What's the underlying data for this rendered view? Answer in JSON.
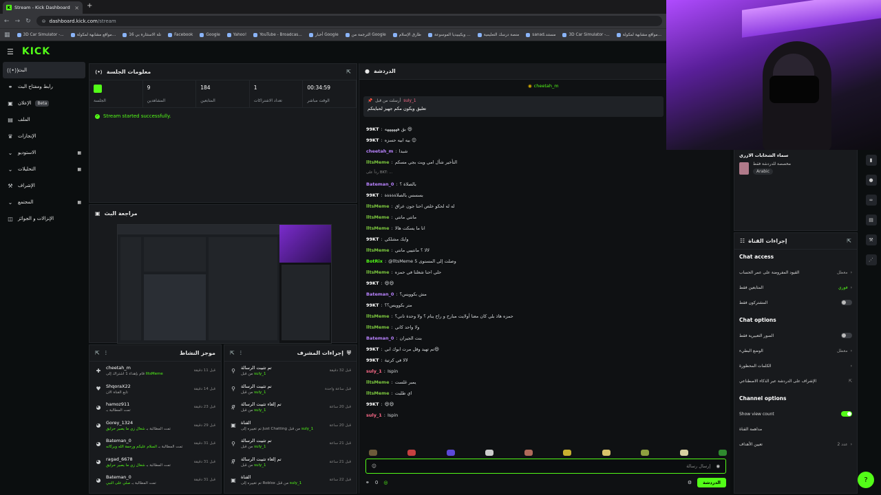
{
  "browser": {
    "tab_title": "Stream - Kick Dashboard",
    "url_host": "dashboard.kick.com",
    "url_path": "/stream",
    "bookmarks": [
      "3D Car Simulator -...",
      "مواقع مشابهة لمكولة...",
      "تلة الاستثارة بي 16",
      "Facebook",
      "Google",
      "Yahoo!",
      "YouTube - Broadcas...",
      "أخبار Google",
      "الترجمة من Google",
      "طارق الإسلام",
      "ويكيبيديا الموسوعة ...",
      "منصة درسك التعليمية",
      "sanad.مستند",
      "3D Car Simulator -...",
      "مواقع مشابهة لمكولة..."
    ]
  },
  "sidebar": {
    "items": [
      {
        "label": "البث",
        "icon": "broadcast-icon",
        "active": true
      },
      {
        "label": "رابط ومفتاح البث",
        "icon": "link-icon"
      },
      {
        "label": "الإعلان",
        "icon": "ads-icon",
        "badge": "Beta"
      },
      {
        "label": "الملف",
        "icon": "file-icon"
      },
      {
        "label": "الإنجازات",
        "icon": "trophy-icon"
      },
      {
        "label": "الاستوديو",
        "icon": "studio-icon",
        "chev": true
      },
      {
        "label": "التحليلات",
        "icon": "analytics-icon",
        "chev": true
      },
      {
        "label": "الإشراف",
        "icon": "moderation-icon"
      },
      {
        "label": "المجتمع",
        "icon": "community-icon",
        "chev": true
      },
      {
        "label": "الإنزالات و الجوائز",
        "icon": "drops-icon"
      }
    ]
  },
  "session": {
    "title": "معلومات الجلسة",
    "stats": [
      {
        "value": "",
        "label": "الجلسة"
      },
      {
        "value": "9",
        "label": "المشاهدين"
      },
      {
        "value": "184",
        "label": "المتابعين"
      },
      {
        "value": "1",
        "label": "تعداد الاشتراكات"
      },
      {
        "value": "00:34:59",
        "label": "الوقت مباشر"
      }
    ],
    "success": "Stream started successfully."
  },
  "preview": {
    "title": "مراجعة البث"
  },
  "activity": {
    "title": "موجز النشاط",
    "items": [
      {
        "name": "cheetah_m",
        "sub": "قام بإهداء 1 اشتراك إلى",
        "hl": "lltsMeme",
        "time": "قبل 11 دقيقة",
        "icon": "gift-icon"
      },
      {
        "name": "ShqoraX22",
        "sub": "تابع القناة الآن",
        "hl": "",
        "time": "قبل 14 دقيقة",
        "icon": "heart-icon"
      },
      {
        "name": "hamoz911",
        "sub": "تمت المطالبة بـ",
        "hl": "",
        "time": "قبل 23 دقيقة",
        "icon": "points-icon"
      },
      {
        "name": "Gorey_1324",
        "sub": "تمت المطالبة بـ",
        "hl": "شغال زي ما يصير حرايق",
        "time": "قبل 29 دقيقة",
        "icon": "points-icon"
      },
      {
        "name": "Bateman_0",
        "sub": "تمت المطالبة بـ",
        "hl": "السلام عليكم ورحمة الله وبركاته",
        "time": "قبل 31 دقيقة",
        "icon": "points-icon"
      },
      {
        "name": "ragad_6678",
        "sub": "تمت المطالبة بـ",
        "hl": "شغال زي ما يصير حرايق",
        "time": "قبل 31 دقيقة",
        "icon": "points-icon"
      },
      {
        "name": "Bateman_0",
        "sub": "تمت المطالبة بـ",
        "hl": "صلي على النبي",
        "time": "قبل 31 دقيقة",
        "icon": "points-icon"
      }
    ]
  },
  "modactions": {
    "title": "إجراءات المشرف",
    "items": [
      {
        "name": "تم تثبيت الرسالة",
        "sub": "من قبل",
        "hl": "suly_1",
        "time": "قبل 32 دقيقة",
        "icon": "pin-icon"
      },
      {
        "name": "تم تثبيت الرسالة",
        "sub": "من قبل",
        "hl": "suly_1",
        "time": "قبل ساعة واحدة",
        "icon": "pin-icon"
      },
      {
        "name": "تم إلغاء تثبيت الرسالة",
        "sub": "من قبل",
        "hl": "suly_1",
        "time": "قبل 20 ساعة",
        "icon": "unpin-icon"
      },
      {
        "name": "القناة",
        "sub": "تم تغييره إلى Just Chatting من قبل",
        "hl": "suly_1",
        "time": "قبل 20 ساعة",
        "icon": "channel-icon"
      },
      {
        "name": "تم تثبيت الرسالة",
        "sub": "من قبل",
        "hl": "suly_1",
        "time": "قبل 21 ساعة",
        "icon": "pin-icon"
      },
      {
        "name": "تم إلغاء تثبيت الرسالة",
        "sub": "من قبل",
        "hl": "suly_1",
        "time": "قبل 21 ساعة",
        "icon": "unpin-icon"
      },
      {
        "name": "القناة",
        "sub": "تم تغييره إلى Roblox من قبل",
        "hl": "suly_1",
        "time": "قبل 22 ساعة",
        "icon": "channel-icon"
      }
    ]
  },
  "chat": {
    "title": "الدردشة",
    "top_user": "cheetah_m",
    "pinned_by": "أرسلت من قبل",
    "pinned_user": "suly_1",
    "pinned_text": "تعليق ويكون مكم جهيز لحبايتكم",
    "messages": [
      {
        "u": "99KT",
        "c": "#ffffff",
        "t": "بق ههههههه 😄"
      },
      {
        "u": "99KT",
        "c": "#ffffff",
        "t": "بيه ابيه حسزه 😊"
      },
      {
        "u": "cheetah_m",
        "c": "#b983ff",
        "t": "شبدا"
      },
      {
        "u": "lltsMeme",
        "c": "#7ecb3f",
        "t": "التأخير شأل امي ويت بجي مسكم"
      },
      {
        "u": "",
        "c": "#888",
        "t": "رداً على BKT: ...",
        "sys": true
      },
      {
        "u": "Bateman_0",
        "c": "#b983ff",
        "t": "بالصلاة ؟"
      },
      {
        "u": "99KT",
        "c": "#ffffff",
        "t": "بسسس بالصلاةةةةة"
      },
      {
        "u": "lltsMeme",
        "c": "#7ecb3f",
        "t": "له له لحكو خلص احنا جون عراق"
      },
      {
        "u": "lltsMeme",
        "c": "#7ecb3f",
        "t": "مانتي مانتي"
      },
      {
        "u": "lltsMeme",
        "c": "#7ecb3f",
        "t": "انا ما يسكت هالا"
      },
      {
        "u": "99KT",
        "c": "#ffffff",
        "t": "وايك مشلكي"
      },
      {
        "u": "lltsMeme",
        "c": "#7ecb3f",
        "t": "لالا ؟ مانتييي مانتي"
      },
      {
        "u": "BotRix",
        "c": "#53fc18",
        "t": "@lltsMeme وصلت إلى المستوى 5"
      },
      {
        "u": "lltsMeme",
        "c": "#7ecb3f",
        "t": "حلي احنا شغلنا في حمزه"
      },
      {
        "u": "99KT",
        "c": "#ffffff",
        "t": "😄😄"
      },
      {
        "u": "Bateman_0",
        "c": "#b983ff",
        "t": "مش بكوويس؟"
      },
      {
        "u": "99KT",
        "c": "#ffffff",
        "t": "متر بكوويس؟؟"
      },
      {
        "u": "lltsMeme",
        "c": "#7ecb3f",
        "t": "حمزه هاذ بلي كان معنا أولايت مبارح و راح ينام ؟ ولا وحدة تاني؟"
      },
      {
        "u": "lltsMeme",
        "c": "#7ecb3f",
        "t": "ولا واحد كاني"
      },
      {
        "u": "Bateman_0",
        "c": "#b983ff",
        "t": "بنت الجيران"
      },
      {
        "u": "99KT",
        "c": "#ffffff",
        "t": "تم تهيد وقل مرت ابوك ابي😄"
      },
      {
        "u": "99KT",
        "c": "#ffffff",
        "t": "لالا في كرتية"
      },
      {
        "u": "suly_1",
        "c": "#ff6b8a",
        "t": "Ispin"
      },
      {
        "u": "lltsMeme",
        "c": "#7ecb3f",
        "t": "يمبر غلست"
      },
      {
        "u": "lltsMeme",
        "c": "#7ecb3f",
        "t": "اي طلبت"
      },
      {
        "u": "99KT",
        "c": "#ffffff",
        "t": "😄😄"
      },
      {
        "u": "suly_1",
        "c": "#ff6b8a",
        "t": "Ispin"
      }
    ],
    "input_placeholder": "إرسال رسالة",
    "send": "الدردشة",
    "count": "0"
  },
  "streamer": {
    "title": "سماء الشخابات الازري",
    "lang_desc": "مخصصة للدردشة فقط",
    "lang": "Arabic"
  },
  "channel_actions": {
    "title": "إجراءات القناة",
    "chat_access": {
      "title": "Chat access",
      "rows": [
        {
          "l": "القيود المفروضة على عمر الحساب",
          "v": "معطل",
          "type": "arrow"
        },
        {
          "l": "المتابعين فقط",
          "v": "فوري",
          "type": "arrow"
        },
        {
          "l": "المشتركون فقط",
          "v": "",
          "type": "toggle"
        }
      ]
    },
    "chat_options": {
      "title": "Chat options",
      "rows": [
        {
          "l": "الصور التعبيرية فقط",
          "v": "",
          "type": "toggle"
        },
        {
          "l": "الوضع البطيء",
          "v": "معطل",
          "type": "arrow"
        },
        {
          "l": "الكلمات المحظورة",
          "v": "",
          "type": "arrow"
        },
        {
          "l": "الإشراف على الدردشة عبر الذكاء الاصطناعي",
          "v": "",
          "type": "link"
        }
      ]
    },
    "channel_options": {
      "title": "Channel options",
      "rows": [
        {
          "l": "Show view count",
          "v": "",
          "type": "toggle-on"
        },
        {
          "l": "مداهمة القناة",
          "v": "",
          "type": "none"
        },
        {
          "l": "تعيين الأهداف",
          "v": "عدد 2",
          "type": "arrow"
        }
      ]
    }
  },
  "colors": {
    "accent": "#53fc18",
    "bg": "#0b0e0f",
    "panel": "#181a1d"
  }
}
